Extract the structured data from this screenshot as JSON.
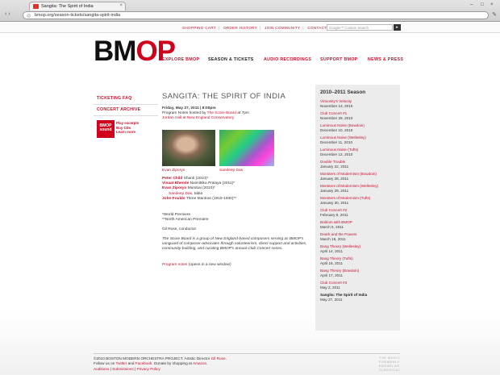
{
  "browser": {
    "tab_title": "Sangita: The Spirit of India",
    "url": "bmop.org/season-tickets/sangita-spirit-india"
  },
  "topbar": {
    "links": [
      "SHOPPING CART",
      "ORDER HISTORY",
      "JOIN COMMUNITY",
      "CONTACT"
    ],
    "search_placeholder": "Google™ Custom Search",
    "search_button": "▸"
  },
  "logo": {
    "part1": "BM",
    "part2": "OP"
  },
  "nav": [
    "EXPLORE BMOP",
    "SEASON & TICKETS",
    "AUDIO RECORDINGS",
    "SUPPORT BMOP",
    "NEWS & PRESS"
  ],
  "sidebar": {
    "links": [
      "TICKETING FAQ",
      "CONCERT ARCHIVE"
    ],
    "promo_badge": "BMOP sound",
    "promo_lines": [
      "Play excerpts",
      "Buy CDs",
      "Learn more"
    ]
  },
  "page_title": "SANGITA: THE SPIRIT OF INDIA",
  "event": {
    "date_line": "Friday, May 27, 2011 | 8:00pm",
    "notes_prefix": "Program Notes hosted by ",
    "notes_link": "The Score Board",
    "notes_suffix": " at 7pm",
    "venue": "Jordan Hall at New England Conservatory"
  },
  "photos": {
    "cap1": "Evan Ziporyn",
    "cap2": "Sandeep Das"
  },
  "program": [
    {
      "composer": "Peter Child",
      "work": " Shanti (2010)*"
    },
    {
      "composer": "Vinaat Bhende",
      "work": " Naimittika Pralaya (2011)*"
    },
    {
      "composer": "Evan Ziporyn",
      "work": " Mumbai (2010)*"
    },
    {
      "composer": "John Foulds",
      "work": " Three Mantras (1919-1930)**"
    }
  ],
  "program_sub": {
    "name": "Sandeep Das",
    "suffix": ", tabla"
  },
  "notes": {
    "premiere1": "*World Premiere",
    "premiere2": "**North American Premiere",
    "conductor": "Gil Rose, conductor",
    "scoreboard": "The Score Board is a group of New England-based composers serving as BMOP's vanguard of composer-advocates through volunteerism, direct support and activities, community-building, and curating BMOP's annual Club Concert series.",
    "program_notes_link": "Program notes",
    "program_notes_suffix": " (opens in a new window)"
  },
  "season": {
    "heading": "2010–2011 Season",
    "items": [
      {
        "name": "Virtuosity's Velocity",
        "date": "November 13, 2010"
      },
      {
        "name": "Club Concert #1",
        "date": "November 29, 2010"
      },
      {
        "name": "Luminous Noise (Bowdoin)",
        "date": "December 10, 2010"
      },
      {
        "name": "Luminous Noise (Wellesley)",
        "date": "December 11, 2010"
      },
      {
        "name": "Luminous Noise (Tufts)",
        "date": "December 12, 2010"
      },
      {
        "name": "Double Trouble",
        "date": "January 22, 2011"
      },
      {
        "name": "Monsters of Modernism (Bowdoin)",
        "date": "January 28, 2011"
      },
      {
        "name": "Monsters of Modernism (Wellesley)",
        "date": "January 29, 2011"
      },
      {
        "name": "Monsters of Modernism (Tufts)",
        "date": "January 30, 2011"
      },
      {
        "name": "Club Concert #2",
        "date": "February 8, 2011"
      },
      {
        "name": "Boléom with BMOP",
        "date": "March 6, 2011"
      },
      {
        "name": "Death and the Powers",
        "date": "March 18, 2011"
      },
      {
        "name": "Bang Theory (Wellesley)",
        "date": "April 14, 2011"
      },
      {
        "name": "Bang Theory (Tufts)",
        "date": "April 16, 2011"
      },
      {
        "name": "Bang Theory (Bowdoin)",
        "date": "April 17, 2011"
      },
      {
        "name": "Club Concert #3",
        "date": "May 2, 2011"
      },
      {
        "name": "Sangita: The Spirit of India",
        "date": "May 27, 2011"
      }
    ]
  },
  "footer": {
    "line1_prefix": "©2010 BOSTON MODERN ORCHESTRA PROJECT. Artistic Director ",
    "line1_link": "Gil Rose",
    "line2_prefix": "Follow us on ",
    "twitter": "Twitter",
    "and": " and ",
    "facebook": "Facebook",
    "line2_mid": ". Donate by shopping at ",
    "amazon": "Amazon",
    "links": [
      "Auditions",
      "Submissions",
      "Privacy Policy"
    ],
    "tagline": [
      "THE MUSIC",
      "FORMERLY",
      "KNOWN AS",
      "CLASSICAL"
    ]
  }
}
